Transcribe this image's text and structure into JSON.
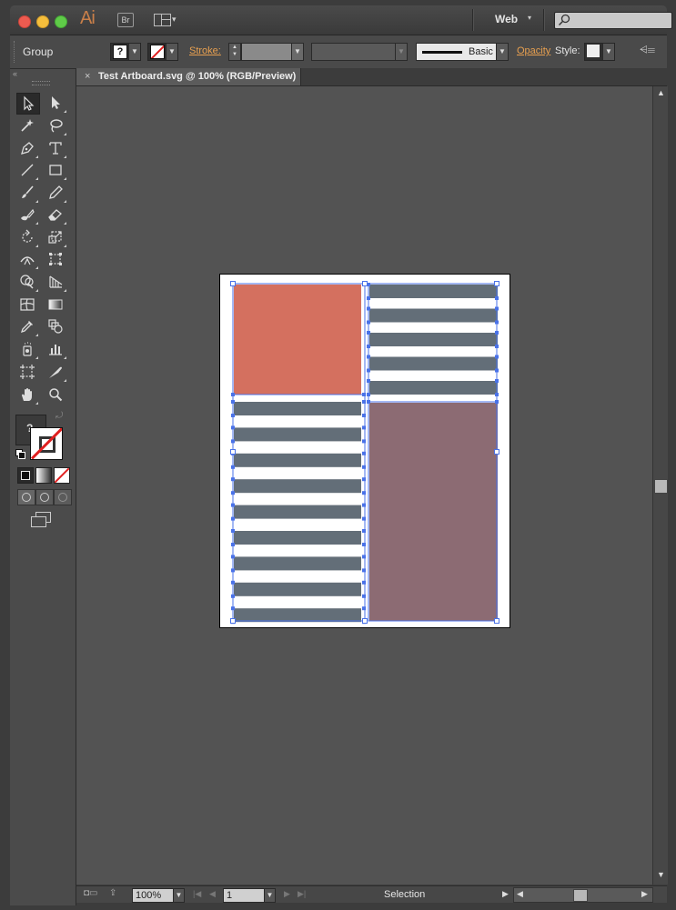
{
  "app": {
    "logo_text": "Ai",
    "bridge_label": "Br",
    "workspace": "Web",
    "search_placeholder": ""
  },
  "control_bar": {
    "selection_type": "Group",
    "fill_label": "?",
    "stroke_label": "Stroke:",
    "brush_label": "Basic",
    "opacity_label": "Opacity",
    "style_label": "Style:",
    "colors": {
      "stroke_none": "#e02020",
      "link_orange": "#e8a050"
    }
  },
  "tools_panel": {
    "collapse_glyph": "«",
    "fill_indicator": "?",
    "tools": [
      "selection-tool",
      "direct-selection-tool",
      "magic-wand-tool",
      "lasso-tool",
      "pen-tool",
      "type-tool",
      "line-segment-tool",
      "rectangle-tool",
      "paintbrush-tool",
      "pencil-tool",
      "blob-brush-tool",
      "eraser-tool",
      "rotate-tool",
      "scale-tool",
      "width-tool",
      "free-transform-tool",
      "shape-builder-tool",
      "perspective-grid-tool",
      "mesh-tool",
      "gradient-tool",
      "eyedropper-tool",
      "blend-tool",
      "symbol-sprayer-tool",
      "column-graph-tool",
      "artboard-tool",
      "slice-tool",
      "hand-tool",
      "zoom-tool"
    ]
  },
  "document": {
    "tab_close": "×",
    "tab_title": "Test Artboard.svg @ 100% (RGB/Preview)"
  },
  "artwork": {
    "colors": {
      "salmon": "#d4705f",
      "mauve": "#8c6b73",
      "slate": "#636e78",
      "selection": "#4a72e8"
    },
    "left_column_bars": 9,
    "right_column_bars": 5
  },
  "status_bar": {
    "zoom": "100%",
    "page": "1",
    "status_text": "Selection"
  }
}
